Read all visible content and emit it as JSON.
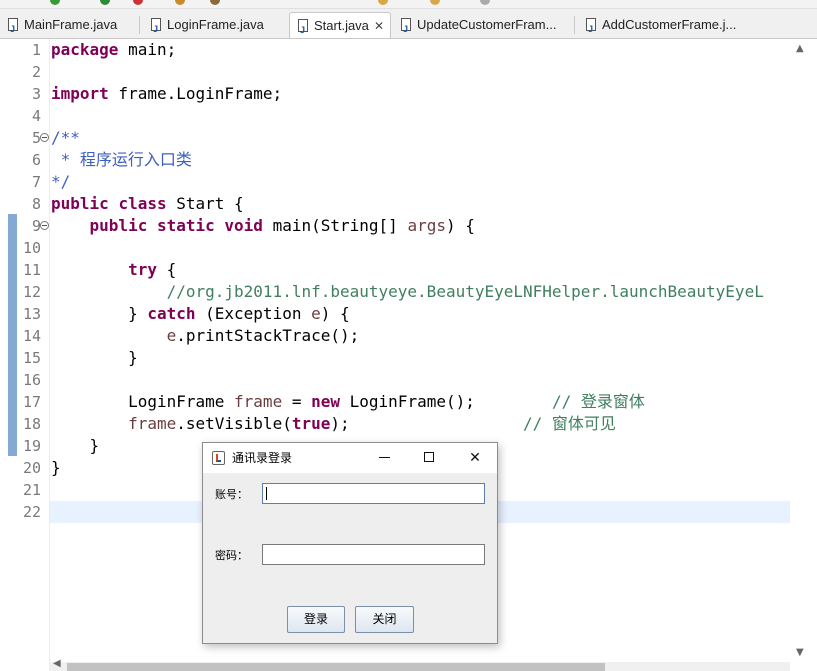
{
  "tabs": [
    {
      "label": "MainFrame.java",
      "active": false
    },
    {
      "label": "LoginFrame.java",
      "active": false
    },
    {
      "label": "Start.java",
      "active": true,
      "close": "✕"
    },
    {
      "label": "UpdateCustomerFram...",
      "active": false
    },
    {
      "label": "AddCustomerFrame.j...",
      "active": false
    }
  ],
  "editor": {
    "lines": [
      {
        "n": "1",
        "html": "<span class='kw'>package</span> main;"
      },
      {
        "n": "2",
        "html": ""
      },
      {
        "n": "3",
        "html": "<span class='kw'>import</span> frame.LoginFrame;"
      },
      {
        "n": "4",
        "html": ""
      },
      {
        "n": "5",
        "html": "<span class='jd'>/**</span>",
        "fold": true
      },
      {
        "n": "6",
        "html": "<span class='jd'> * 程序运行入口类</span>"
      },
      {
        "n": "7",
        "html": "<span class='jd'>*/</span>"
      },
      {
        "n": "8",
        "html": "<span class='kw'>public</span> <span class='kw'>class</span> Start {"
      },
      {
        "n": "9",
        "html": "    <span class='kw'>public</span> <span class='kw'>static</span> <span class='kw'>void</span> main(String[] <span class='var'>args</span>) {",
        "fold": true
      },
      {
        "n": "10",
        "html": ""
      },
      {
        "n": "11",
        "html": "        <span class='kw'>try</span> {"
      },
      {
        "n": "12",
        "html": "            <span class='cm'>//org.jb2011.lnf.beautyeye.BeautyEyeLNFHelper.launchBeautyEyeL</span>"
      },
      {
        "n": "13",
        "html": "        } <span class='kw'>catch</span> (Exception <span class='var'>e</span>) {"
      },
      {
        "n": "14",
        "html": "            <span class='var'>e</span>.printStackTrace();"
      },
      {
        "n": "15",
        "html": "        }"
      },
      {
        "n": "16",
        "html": ""
      },
      {
        "n": "17",
        "html": "        LoginFrame <span class='var'>frame</span> = <span class='kw'>new</span> LoginFrame();        <span class='cm'>// 登录窗体</span>"
      },
      {
        "n": "18",
        "html": "        <span class='var'>frame</span>.setVisible(<span class='kw'>true</span>);                  <span class='cm'>// 窗体可见</span>"
      },
      {
        "n": "19",
        "html": "    }"
      },
      {
        "n": "20",
        "html": "}"
      },
      {
        "n": "21",
        "html": ""
      },
      {
        "n": "22",
        "html": ""
      }
    ]
  },
  "dialog": {
    "title": "通讯录登录",
    "account_label": "账号：",
    "account_value": "",
    "password_label": "密码：",
    "password_value": "",
    "login_button": "登录",
    "close_button": "关闭",
    "close_glyph": "✕"
  },
  "colors": {
    "keyword": "#7f0055",
    "comment": "#3f7f5f",
    "javadoc": "#3f5fbf",
    "variable": "#6a3e3e",
    "change_bar": "#5b8cc4",
    "current_line": "#e8f2fe"
  },
  "icons": {
    "file": "java-file-icon",
    "app": "java-app-icon"
  }
}
